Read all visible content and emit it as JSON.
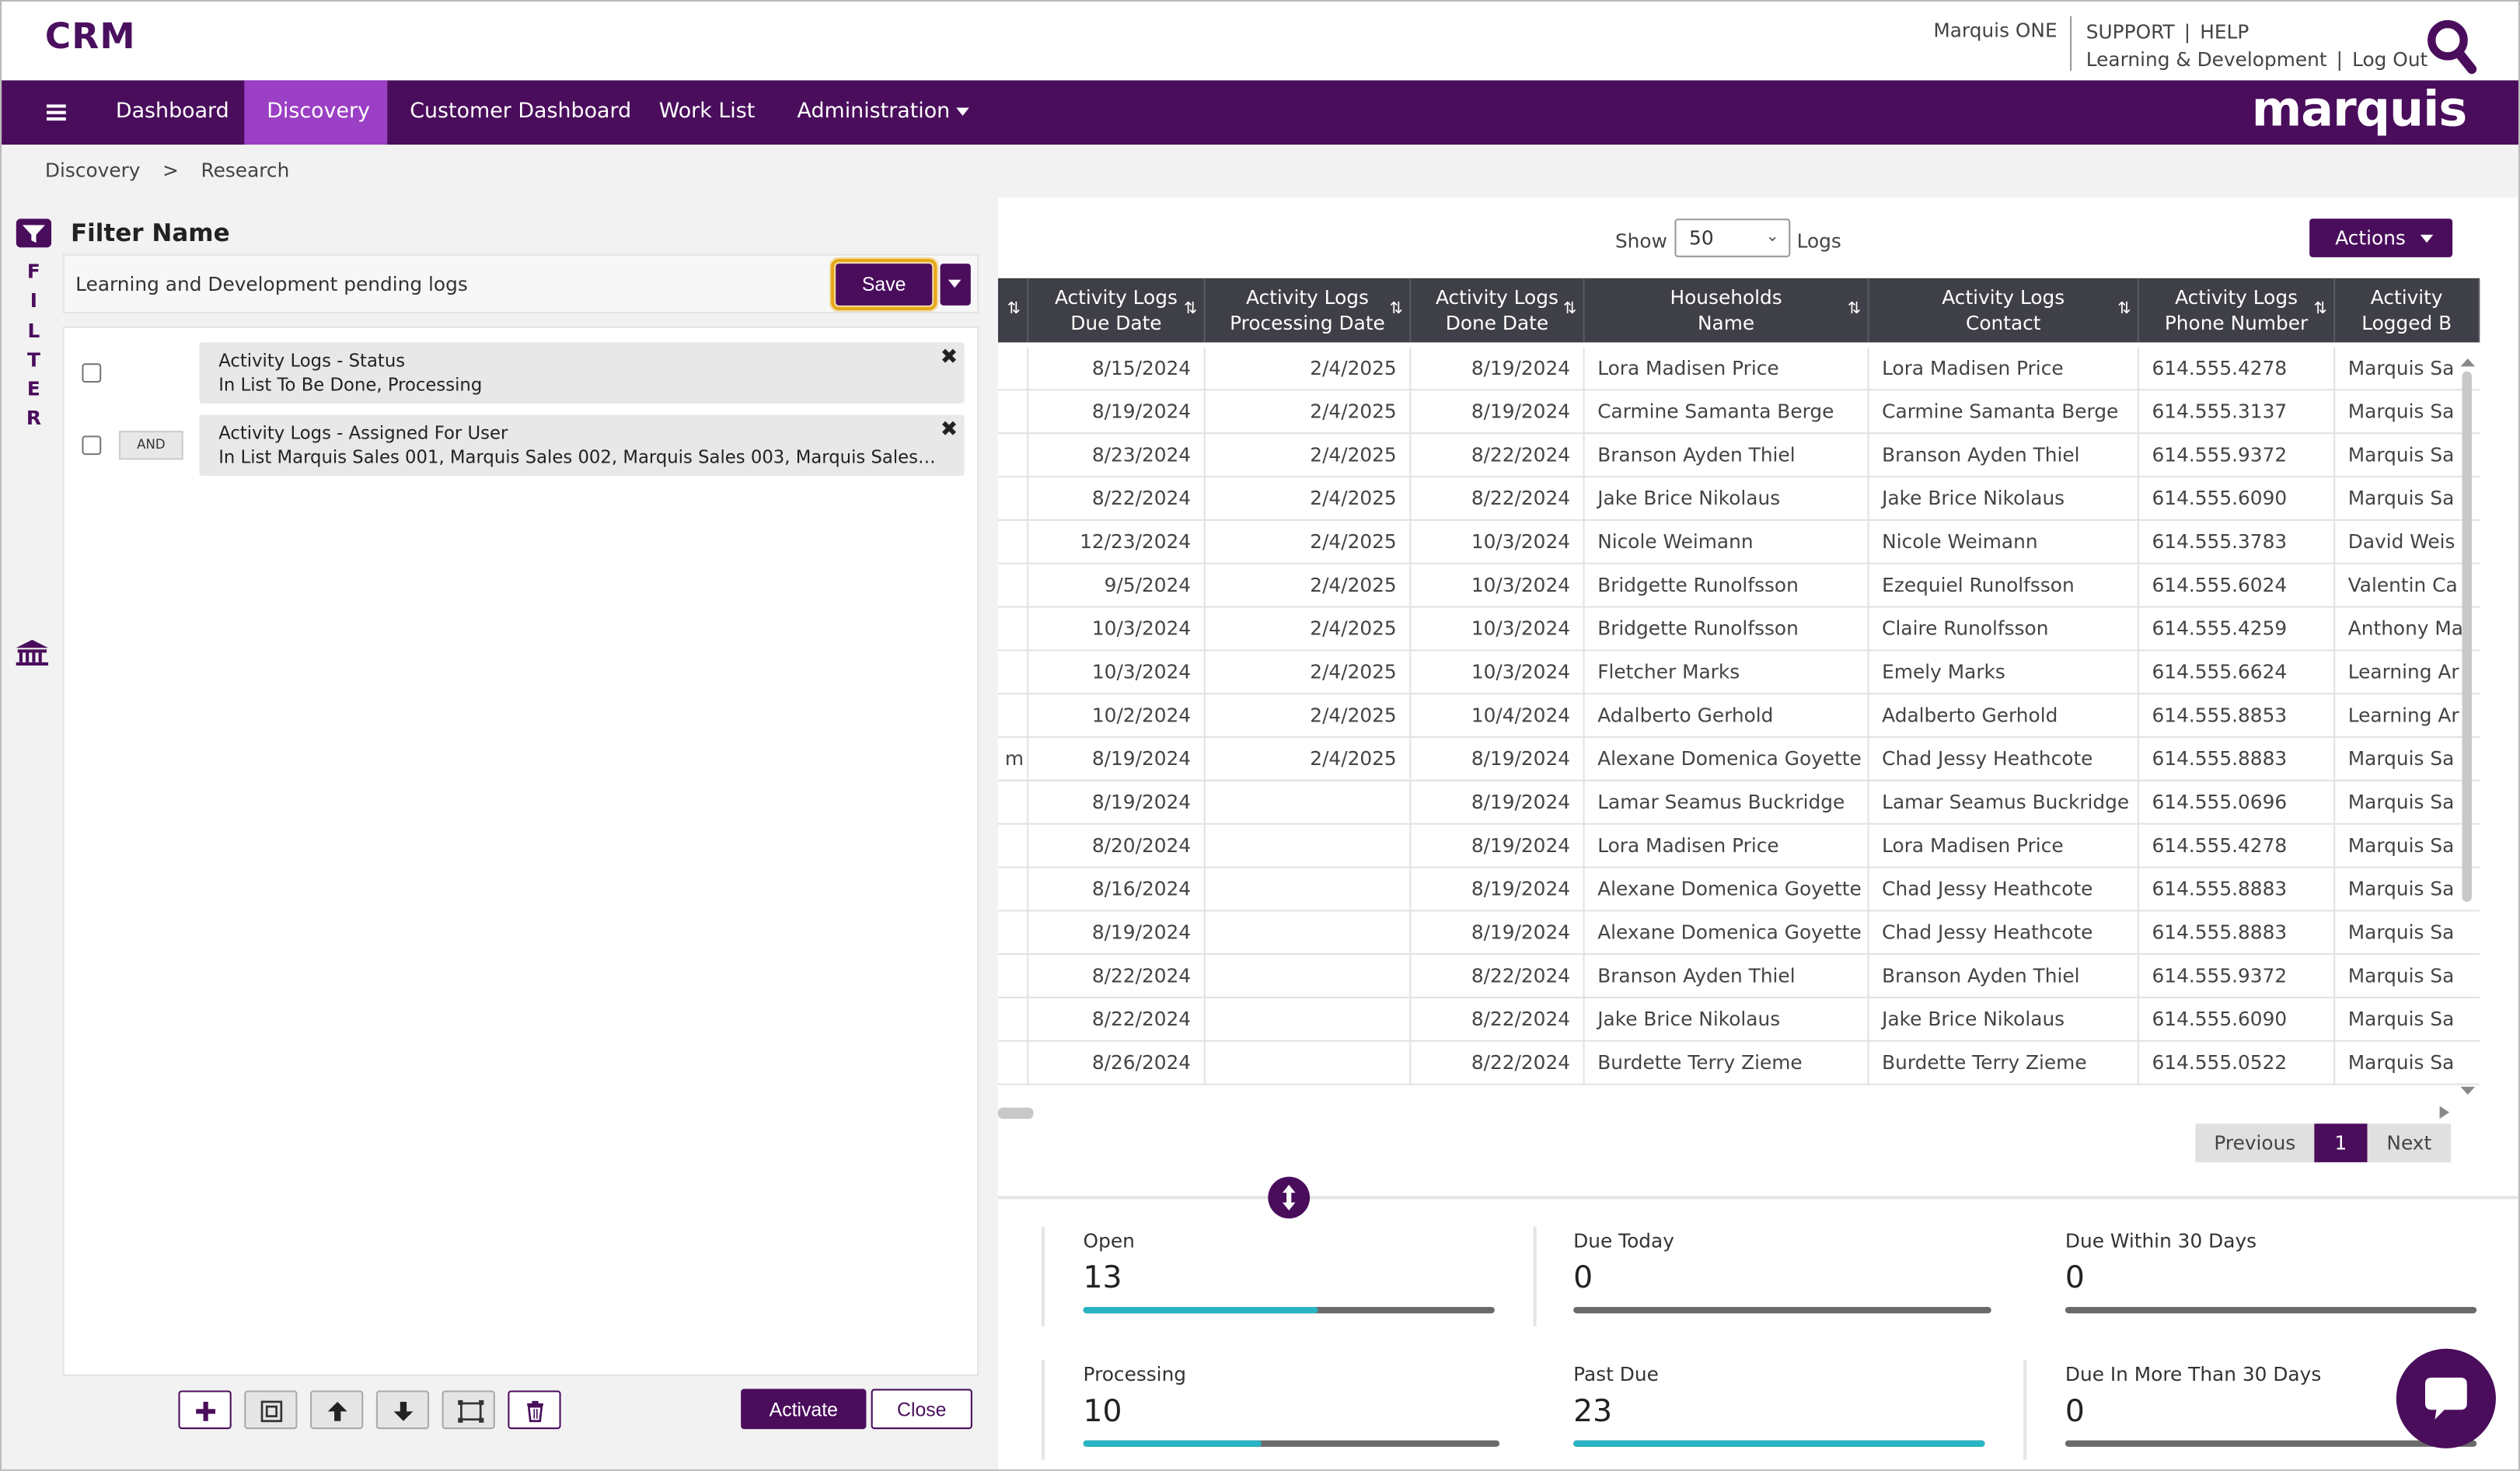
{
  "header": {
    "logo": "CRM",
    "org_name": "Marquis ONE",
    "support": "SUPPORT",
    "help": "HELP",
    "learning": "Learning & Development",
    "logout": "Log Out",
    "sep": "|"
  },
  "nav": {
    "items": [
      {
        "label": "Dashboard"
      },
      {
        "label": "Discovery"
      },
      {
        "label": "Customer Dashboard"
      },
      {
        "label": "Work List"
      },
      {
        "label": "Administration"
      }
    ],
    "brand": "marquis"
  },
  "breadcrumb": {
    "items": [
      "Discovery",
      ">",
      "Research"
    ]
  },
  "rail": {
    "letters": "FILTER"
  },
  "filter": {
    "title": "Filter Name",
    "name": "Learning and Development pending logs",
    "save": "Save",
    "criteria": [
      {
        "line1": "Activity Logs - Status",
        "line2": "In List To Be Done, Processing",
        "connector": ""
      },
      {
        "line1": "Activity Logs - Assigned For User",
        "line2": "In List Marquis Sales 001, Marquis Sales 002, Marquis Sales 003, Marquis Sales 00...",
        "connector": "AND"
      }
    ],
    "remove": "✖",
    "activate": "Activate",
    "close": "Close"
  },
  "grid": {
    "show": "Show",
    "page_size": "50",
    "logs": "Logs",
    "actions": "Actions",
    "headers": [
      {
        "l1": "",
        "l2": ""
      },
      {
        "l1": "Activity Logs",
        "l2": "Due Date"
      },
      {
        "l1": "Activity Logs",
        "l2": "Processing Date"
      },
      {
        "l1": "Activity Logs",
        "l2": "Done Date"
      },
      {
        "l1": "Households",
        "l2": "Name"
      },
      {
        "l1": "Activity Logs",
        "l2": "Contact"
      },
      {
        "l1": "Activity Logs",
        "l2": "Phone Number"
      },
      {
        "l1": "Activity",
        "l2": "Logged B"
      }
    ],
    "sort_icon": "⇅",
    "rows": [
      [
        "",
        "8/15/2024",
        "2/4/2025",
        "8/19/2024",
        "Lora Madisen Price",
        "Lora Madisen Price",
        "614.555.4278",
        "Marquis Sa"
      ],
      [
        "",
        "8/19/2024",
        "2/4/2025",
        "8/19/2024",
        "Carmine Samanta Berge",
        "Carmine Samanta Berge",
        "614.555.3137",
        "Marquis Sa"
      ],
      [
        "",
        "8/23/2024",
        "2/4/2025",
        "8/22/2024",
        "Branson Ayden Thiel",
        "Branson Ayden Thiel",
        "614.555.9372",
        "Marquis Sa"
      ],
      [
        "",
        "8/22/2024",
        "2/4/2025",
        "8/22/2024",
        "Jake Brice Nikolaus",
        "Jake Brice Nikolaus",
        "614.555.6090",
        "Marquis Sa"
      ],
      [
        "",
        "12/23/2024",
        "2/4/2025",
        "10/3/2024",
        "Nicole Weimann",
        "Nicole Weimann",
        "614.555.3783",
        "David Weis"
      ],
      [
        "",
        "9/5/2024",
        "2/4/2025",
        "10/3/2024",
        "Bridgette Runolfsson",
        "Ezequiel Runolfsson",
        "614.555.6024",
        "Valentin Ca"
      ],
      [
        "",
        "10/3/2024",
        "2/4/2025",
        "10/3/2024",
        "Bridgette Runolfsson",
        "Claire Runolfsson",
        "614.555.4259",
        "Anthony Ma"
      ],
      [
        "",
        "10/3/2024",
        "2/4/2025",
        "10/3/2024",
        "Fletcher Marks",
        "Emely Marks",
        "614.555.6624",
        "Learning Ar"
      ],
      [
        "",
        "10/2/2024",
        "2/4/2025",
        "10/4/2024",
        "Adalberto Gerhold",
        "Adalberto Gerhold",
        "614.555.8853",
        "Learning Ar"
      ],
      [
        "m",
        "8/19/2024",
        "2/4/2025",
        "8/19/2024",
        "Alexane Domenica Goyette",
        "Chad Jessy Heathcote",
        "614.555.8883",
        "Marquis Sa"
      ],
      [
        "",
        "8/19/2024",
        "",
        "8/19/2024",
        "Lamar Seamus Buckridge",
        "Lamar Seamus Buckridge",
        "614.555.0696",
        "Marquis Sa"
      ],
      [
        "",
        "8/20/2024",
        "",
        "8/19/2024",
        "Lora Madisen Price",
        "Lora Madisen Price",
        "614.555.4278",
        "Marquis Sa"
      ],
      [
        "",
        "8/16/2024",
        "",
        "8/19/2024",
        "Alexane Domenica Goyette",
        "Chad Jessy Heathcote",
        "614.555.8883",
        "Marquis Sa"
      ],
      [
        "",
        "8/19/2024",
        "",
        "8/19/2024",
        "Alexane Domenica Goyette",
        "Chad Jessy Heathcote",
        "614.555.8883",
        "Marquis Sa"
      ],
      [
        "",
        "8/22/2024",
        "",
        "8/22/2024",
        "Branson Ayden Thiel",
        "Branson Ayden Thiel",
        "614.555.9372",
        "Marquis Sa"
      ],
      [
        "",
        "8/22/2024",
        "",
        "8/22/2024",
        "Jake Brice Nikolaus",
        "Jake Brice Nikolaus",
        "614.555.6090",
        "Marquis Sa"
      ],
      [
        "",
        "8/26/2024",
        "",
        "8/22/2024",
        "Burdette Terry Zieme",
        "Burdette Terry Zieme",
        "614.555.0522",
        "Marquis Sa"
      ]
    ],
    "pager": {
      "previous": "Previous",
      "page": "1",
      "next": "Next"
    }
  },
  "stats": [
    {
      "label": "Open",
      "value": "13",
      "fill": 0.57
    },
    {
      "label": "Due Today",
      "value": "0",
      "fill": 0
    },
    {
      "label": "Due Within 30 Days",
      "value": "0",
      "fill": 0
    },
    {
      "label": "Processing",
      "value": "10",
      "fill": 0.43
    },
    {
      "label": "Past Due",
      "value": "23",
      "fill": 1.0
    },
    {
      "label": "Due In More Than 30 Days",
      "value": "0",
      "fill": 0
    }
  ],
  "colors": {
    "primary": "#4a0d5c",
    "accent": "#9b3fc4",
    "highlight": "#e6a817",
    "progress": "#29b4c4"
  }
}
